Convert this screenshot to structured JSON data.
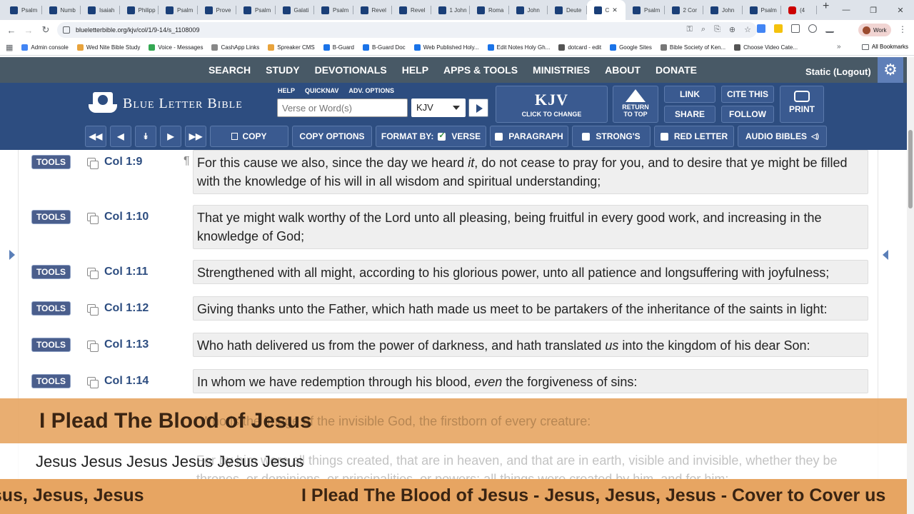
{
  "browser": {
    "tabs": [
      "Psalm",
      "Numb",
      "Isaiah",
      "Philipp",
      "Psalm",
      "Prove",
      "Psalm",
      "Galati",
      "Psalm",
      "Revel",
      "Revel",
      "1 John",
      "Roma",
      "John",
      "Deute",
      "C",
      "Psalm",
      "2 Cor",
      "John",
      "Psalm",
      "(4"
    ],
    "active_tab_index": 15,
    "address": "blueletterbible.org/kjv/col/1/9-14/s_1108009",
    "profile": "Work",
    "bookmarks": [
      "Admin console",
      "Wed Nite Bible Study",
      "Voice - Messages",
      "CashApp Links",
      "Spreaker CMS",
      "B-Guard",
      "B-Guard Doc",
      "Web Published Holy...",
      "Edit Notes Holy Gh...",
      "dotcard - edit",
      "Google Sites",
      "Bible Society of Ken...",
      "Choose Video Cate..."
    ],
    "all_bookmarks": "All Bookmarks"
  },
  "site": {
    "nav": [
      "SEARCH",
      "STUDY",
      "DEVOTIONALS",
      "HELP",
      "APPS & TOOLS",
      "MINISTRIES",
      "ABOUT",
      "DONATE"
    ],
    "user_status": "Static (Logout)",
    "logo_text": "Blue Letter Bible",
    "small_links": [
      "HELP",
      "QUICKNAV",
      "ADV. OPTIONS"
    ],
    "search_placeholder": "Verse or Word(s)",
    "version": "KJV",
    "kjv_big": "KJV",
    "kjv_small": "CLICK TO CHANGE",
    "return_top": "RETURN TO TOP",
    "link": "LINK",
    "cite": "CITE THIS",
    "share": "SHARE",
    "follow": "FOLLOW",
    "print": "PRINT",
    "copy": "COPY",
    "copy_options": "COPY OPTIONS",
    "format_by": "FORMAT BY:",
    "verse_opt": "VERSE",
    "paragraph_opt": "PARAGRAPH",
    "strongs_opt": "STRONG'S",
    "red_letter_opt": "RED LETTER",
    "audio": "AUDIO BIBLES"
  },
  "verses": [
    {
      "tools": "TOOLS",
      "ref": "Col 1:9",
      "pre": "For this cause we also, since the day we heard ",
      "it": "it",
      "post": ", do not cease to pray for you, and to desire that ye might be filled with the knowledge of his will in all wisdom and spiritual understanding;"
    },
    {
      "tools": "TOOLS",
      "ref": "Col 1:10",
      "pre": "That ye might walk worthy of the Lord unto all pleasing, being fruitful in every good work, and increasing in the knowledge of God;",
      "it": "",
      "post": ""
    },
    {
      "tools": "TOOLS",
      "ref": "Col 1:11",
      "pre": "Strengthened with all might, according to his glorious power, unto all patience and longsuffering with joyfulness;",
      "it": "",
      "post": ""
    },
    {
      "tools": "TOOLS",
      "ref": "Col 1:12",
      "pre": "Giving thanks unto the Father, which hath made us meet to be partakers of the inheritance of the saints in light:",
      "it": "",
      "post": ""
    },
    {
      "tools": "TOOLS",
      "ref": "Col 1:13",
      "pre": "Who hath delivered us from the power of darkness, and hath translated ",
      "it": "us",
      "post": " into the kingdom of his dear Son:"
    },
    {
      "tools": "TOOLS",
      "ref": "Col 1:14",
      "pre": "In whom we have redemption through his blood, ",
      "it": "even",
      "post": " the forgiveness of sins:"
    }
  ],
  "overlay": {
    "title": "I Plead The Blood of Jesus",
    "ghost_verse": "Who is the image of the invisible God, the firstborn of every creature:",
    "subtitle": "Jesus Jesus Jesus Jesus Jesus Jesus",
    "ghost_verse2": "For by him were all things created, that are in heaven, and that are in earth, visible and invisible, whether they be thrones, or dominions, or principalities, or powers: all things were created by him, and for him:",
    "ticker_left": "esus, Jesus, Jesus",
    "ticker_right": "I Plead The Blood of Jesus - Jesus, Jesus, Jesus - Cover to Cover us"
  }
}
